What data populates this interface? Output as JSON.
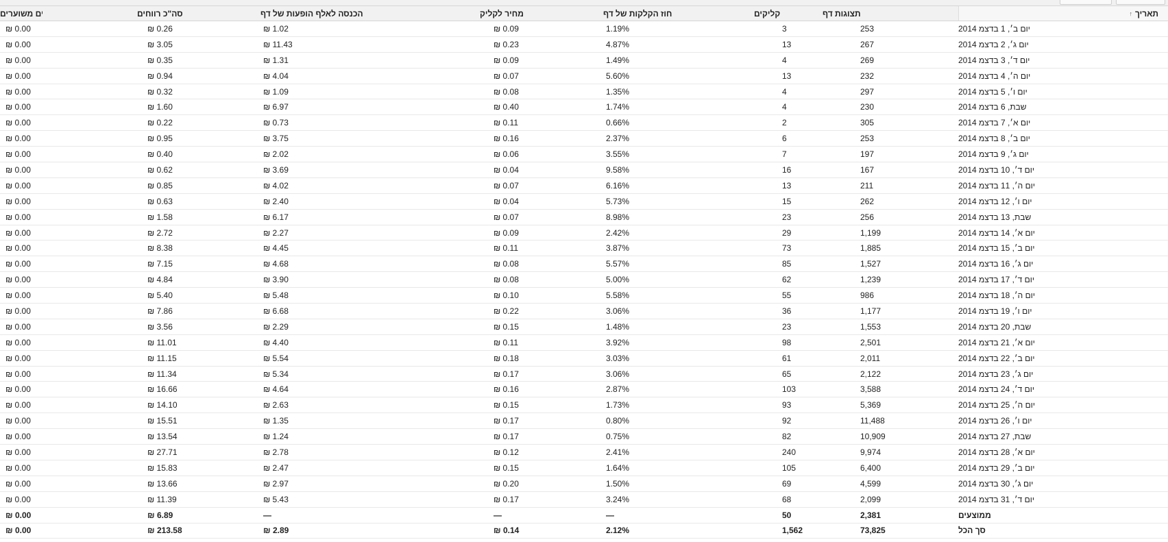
{
  "columns": {
    "date": "תאריך",
    "page_views": "תצוגות דף",
    "clicks": "קליקים",
    "page_ctr": "אחוז הקלקות של דף",
    "cpc": "מחיר לקליק",
    "page_rpm": "הכנסה לאלף הופעות של דף",
    "earnings": "סה\"כ רווחים",
    "estimated_earnings": "רווחים משוערים"
  },
  "sort_icon": "↑",
  "rows": [
    {
      "date": "יום ב׳, 1 בדצמ 2014",
      "views": "253",
      "clicks": "3",
      "ctr": "1.19%",
      "cpc": "₪ 0.09",
      "rpm": "₪ 1.02",
      "earnings": "₪ 0.26",
      "est": "₪ 0.00"
    },
    {
      "date": "יום ג׳, 2 בדצמ 2014",
      "views": "267",
      "clicks": "13",
      "ctr": "4.87%",
      "cpc": "₪ 0.23",
      "rpm": "₪ 11.43",
      "earnings": "₪ 3.05",
      "est": "₪ 0.00"
    },
    {
      "date": "יום ד׳, 3 בדצמ 2014",
      "views": "269",
      "clicks": "4",
      "ctr": "1.49%",
      "cpc": "₪ 0.09",
      "rpm": "₪ 1.31",
      "earnings": "₪ 0.35",
      "est": "₪ 0.00"
    },
    {
      "date": "יום ה׳, 4 בדצמ 2014",
      "views": "232",
      "clicks": "13",
      "ctr": "5.60%",
      "cpc": "₪ 0.07",
      "rpm": "₪ 4.04",
      "earnings": "₪ 0.94",
      "est": "₪ 0.00"
    },
    {
      "date": "יום ו׳, 5 בדצמ 2014",
      "views": "297",
      "clicks": "4",
      "ctr": "1.35%",
      "cpc": "₪ 0.08",
      "rpm": "₪ 1.09",
      "earnings": "₪ 0.32",
      "est": "₪ 0.00"
    },
    {
      "date": "שבת, 6 בדצמ 2014",
      "views": "230",
      "clicks": "4",
      "ctr": "1.74%",
      "cpc": "₪ 0.40",
      "rpm": "₪ 6.97",
      "earnings": "₪ 1.60",
      "est": "₪ 0.00"
    },
    {
      "date": "יום א׳, 7 בדצמ 2014",
      "views": "305",
      "clicks": "2",
      "ctr": "0.66%",
      "cpc": "₪ 0.11",
      "rpm": "₪ 0.73",
      "earnings": "₪ 0.22",
      "est": "₪ 0.00"
    },
    {
      "date": "יום ב׳, 8 בדצמ 2014",
      "views": "253",
      "clicks": "6",
      "ctr": "2.37%",
      "cpc": "₪ 0.16",
      "rpm": "₪ 3.75",
      "earnings": "₪ 0.95",
      "est": "₪ 0.00"
    },
    {
      "date": "יום ג׳, 9 בדצמ 2014",
      "views": "197",
      "clicks": "7",
      "ctr": "3.55%",
      "cpc": "₪ 0.06",
      "rpm": "₪ 2.02",
      "earnings": "₪ 0.40",
      "est": "₪ 0.00"
    },
    {
      "date": "יום ד׳, 10 בדצמ 2014",
      "views": "167",
      "clicks": "16",
      "ctr": "9.58%",
      "cpc": "₪ 0.04",
      "rpm": "₪ 3.69",
      "earnings": "₪ 0.62",
      "est": "₪ 0.00"
    },
    {
      "date": "יום ה׳, 11 בדצמ 2014",
      "views": "211",
      "clicks": "13",
      "ctr": "6.16%",
      "cpc": "₪ 0.07",
      "rpm": "₪ 4.02",
      "earnings": "₪ 0.85",
      "est": "₪ 0.00"
    },
    {
      "date": "יום ו׳, 12 בדצמ 2014",
      "views": "262",
      "clicks": "15",
      "ctr": "5.73%",
      "cpc": "₪ 0.04",
      "rpm": "₪ 2.40",
      "earnings": "₪ 0.63",
      "est": "₪ 0.00"
    },
    {
      "date": "שבת, 13 בדצמ 2014",
      "views": "256",
      "clicks": "23",
      "ctr": "8.98%",
      "cpc": "₪ 0.07",
      "rpm": "₪ 6.17",
      "earnings": "₪ 1.58",
      "est": "₪ 0.00"
    },
    {
      "date": "יום א׳, 14 בדצמ 2014",
      "views": "1,199",
      "clicks": "29",
      "ctr": "2.42%",
      "cpc": "₪ 0.09",
      "rpm": "₪ 2.27",
      "earnings": "₪ 2.72",
      "est": "₪ 0.00"
    },
    {
      "date": "יום ב׳, 15 בדצמ 2014",
      "views": "1,885",
      "clicks": "73",
      "ctr": "3.87%",
      "cpc": "₪ 0.11",
      "rpm": "₪ 4.45",
      "earnings": "₪ 8.38",
      "est": "₪ 0.00"
    },
    {
      "date": "יום ג׳, 16 בדצמ 2014",
      "views": "1,527",
      "clicks": "85",
      "ctr": "5.57%",
      "cpc": "₪ 0.08",
      "rpm": "₪ 4.68",
      "earnings": "₪ 7.15",
      "est": "₪ 0.00"
    },
    {
      "date": "יום ד׳, 17 בדצמ 2014",
      "views": "1,239",
      "clicks": "62",
      "ctr": "5.00%",
      "cpc": "₪ 0.08",
      "rpm": "₪ 3.90",
      "earnings": "₪ 4.84",
      "est": "₪ 0.00"
    },
    {
      "date": "יום ה׳, 18 בדצמ 2014",
      "views": "986",
      "clicks": "55",
      "ctr": "5.58%",
      "cpc": "₪ 0.10",
      "rpm": "₪ 5.48",
      "earnings": "₪ 5.40",
      "est": "₪ 0.00"
    },
    {
      "date": "יום ו׳, 19 בדצמ 2014",
      "views": "1,177",
      "clicks": "36",
      "ctr": "3.06%",
      "cpc": "₪ 0.22",
      "rpm": "₪ 6.68",
      "earnings": "₪ 7.86",
      "est": "₪ 0.00"
    },
    {
      "date": "שבת, 20 בדצמ 2014",
      "views": "1,553",
      "clicks": "23",
      "ctr": "1.48%",
      "cpc": "₪ 0.15",
      "rpm": "₪ 2.29",
      "earnings": "₪ 3.56",
      "est": "₪ 0.00"
    },
    {
      "date": "יום א׳, 21 בדצמ 2014",
      "views": "2,501",
      "clicks": "98",
      "ctr": "3.92%",
      "cpc": "₪ 0.11",
      "rpm": "₪ 4.40",
      "earnings": "₪ 11.01",
      "est": "₪ 0.00"
    },
    {
      "date": "יום ב׳, 22 בדצמ 2014",
      "views": "2,011",
      "clicks": "61",
      "ctr": "3.03%",
      "cpc": "₪ 0.18",
      "rpm": "₪ 5.54",
      "earnings": "₪ 11.15",
      "est": "₪ 0.00"
    },
    {
      "date": "יום ג׳, 23 בדצמ 2014",
      "views": "2,122",
      "clicks": "65",
      "ctr": "3.06%",
      "cpc": "₪ 0.17",
      "rpm": "₪ 5.34",
      "earnings": "₪ 11.34",
      "est": "₪ 0.00"
    },
    {
      "date": "יום ד׳, 24 בדצמ 2014",
      "views": "3,588",
      "clicks": "103",
      "ctr": "2.87%",
      "cpc": "₪ 0.16",
      "rpm": "₪ 4.64",
      "earnings": "₪ 16.66",
      "est": "₪ 0.00"
    },
    {
      "date": "יום ה׳, 25 בדצמ 2014",
      "views": "5,369",
      "clicks": "93",
      "ctr": "1.73%",
      "cpc": "₪ 0.15",
      "rpm": "₪ 2.63",
      "earnings": "₪ 14.10",
      "est": "₪ 0.00"
    },
    {
      "date": "יום ו׳, 26 בדצמ 2014",
      "views": "11,488",
      "clicks": "92",
      "ctr": "0.80%",
      "cpc": "₪ 0.17",
      "rpm": "₪ 1.35",
      "earnings": "₪ 15.51",
      "est": "₪ 0.00"
    },
    {
      "date": "שבת, 27 בדצמ 2014",
      "views": "10,909",
      "clicks": "82",
      "ctr": "0.75%",
      "cpc": "₪ 0.17",
      "rpm": "₪ 1.24",
      "earnings": "₪ 13.54",
      "est": "₪ 0.00"
    },
    {
      "date": "יום א׳, 28 בדצמ 2014",
      "views": "9,974",
      "clicks": "240",
      "ctr": "2.41%",
      "cpc": "₪ 0.12",
      "rpm": "₪ 2.78",
      "earnings": "₪ 27.71",
      "est": "₪ 0.00"
    },
    {
      "date": "יום ב׳, 29 בדצמ 2014",
      "views": "6,400",
      "clicks": "105",
      "ctr": "1.64%",
      "cpc": "₪ 0.15",
      "rpm": "₪ 2.47",
      "earnings": "₪ 15.83",
      "est": "₪ 0.00"
    },
    {
      "date": "יום ג׳, 30 בדצמ 2014",
      "views": "4,599",
      "clicks": "69",
      "ctr": "1.50%",
      "cpc": "₪ 0.20",
      "rpm": "₪ 2.97",
      "earnings": "₪ 13.66",
      "est": "₪ 0.00"
    },
    {
      "date": "יום ד׳, 31 בדצמ 2014",
      "views": "2,099",
      "clicks": "68",
      "ctr": "3.24%",
      "cpc": "₪ 0.17",
      "rpm": "₪ 5.43",
      "earnings": "₪ 11.39",
      "est": "₪ 0.00"
    }
  ],
  "averages": {
    "date": "ממוצעים",
    "views": "2,381",
    "clicks": "50",
    "ctr": "—",
    "cpc": "—",
    "rpm": "—",
    "earnings": "₪ 6.89",
    "est": "₪ 0.00"
  },
  "totals": {
    "date": "סך הכל",
    "views": "73,825",
    "clicks": "1,562",
    "ctr": "2.12%",
    "cpc": "₪ 0.14",
    "rpm": "₪ 2.89",
    "earnings": "₪ 213.58",
    "est": "₪ 0.00"
  }
}
